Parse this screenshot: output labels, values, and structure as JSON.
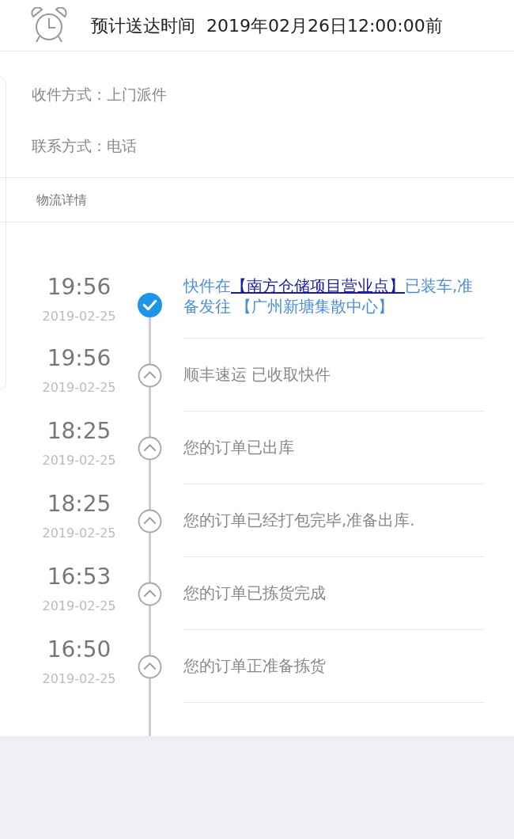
{
  "header": {
    "title": "预计送达时间  2019年02月26日12:00:00前"
  },
  "info": [
    {
      "label": "收件方式：",
      "value": "上门派件"
    },
    {
      "label": "联系方式：",
      "value": "电话"
    }
  ],
  "section_title": "物流详情",
  "events": [
    {
      "time": "19:56",
      "date": "2019-02-25",
      "current": true,
      "segments": [
        {
          "kind": "text",
          "text": "快件在"
        },
        {
          "kind": "link",
          "text": "【南方仓储项目营业点】"
        },
        {
          "kind": "text",
          "text": "已装车,准备发往  【广州新塘集散中心】"
        }
      ]
    },
    {
      "time": "19:56",
      "date": "2019-02-25",
      "current": false,
      "segments": [
        {
          "kind": "text",
          "text": "顺丰速运  已收取快件"
        }
      ]
    },
    {
      "time": "18:25",
      "date": "2019-02-25",
      "current": false,
      "segments": [
        {
          "kind": "text",
          "text": "您的订单已出库"
        }
      ]
    },
    {
      "time": "18:25",
      "date": "2019-02-25",
      "current": false,
      "segments": [
        {
          "kind": "text",
          "text": "您的订单已经打包完毕,准备出库."
        }
      ]
    },
    {
      "time": "16:53",
      "date": "2019-02-25",
      "current": false,
      "segments": [
        {
          "kind": "text",
          "text": "您的订单已拣货完成"
        }
      ]
    },
    {
      "time": "16:50",
      "date": "2019-02-25",
      "current": false,
      "segments": [
        {
          "kind": "text",
          "text": "您的订单正准备拣货"
        }
      ]
    }
  ]
}
